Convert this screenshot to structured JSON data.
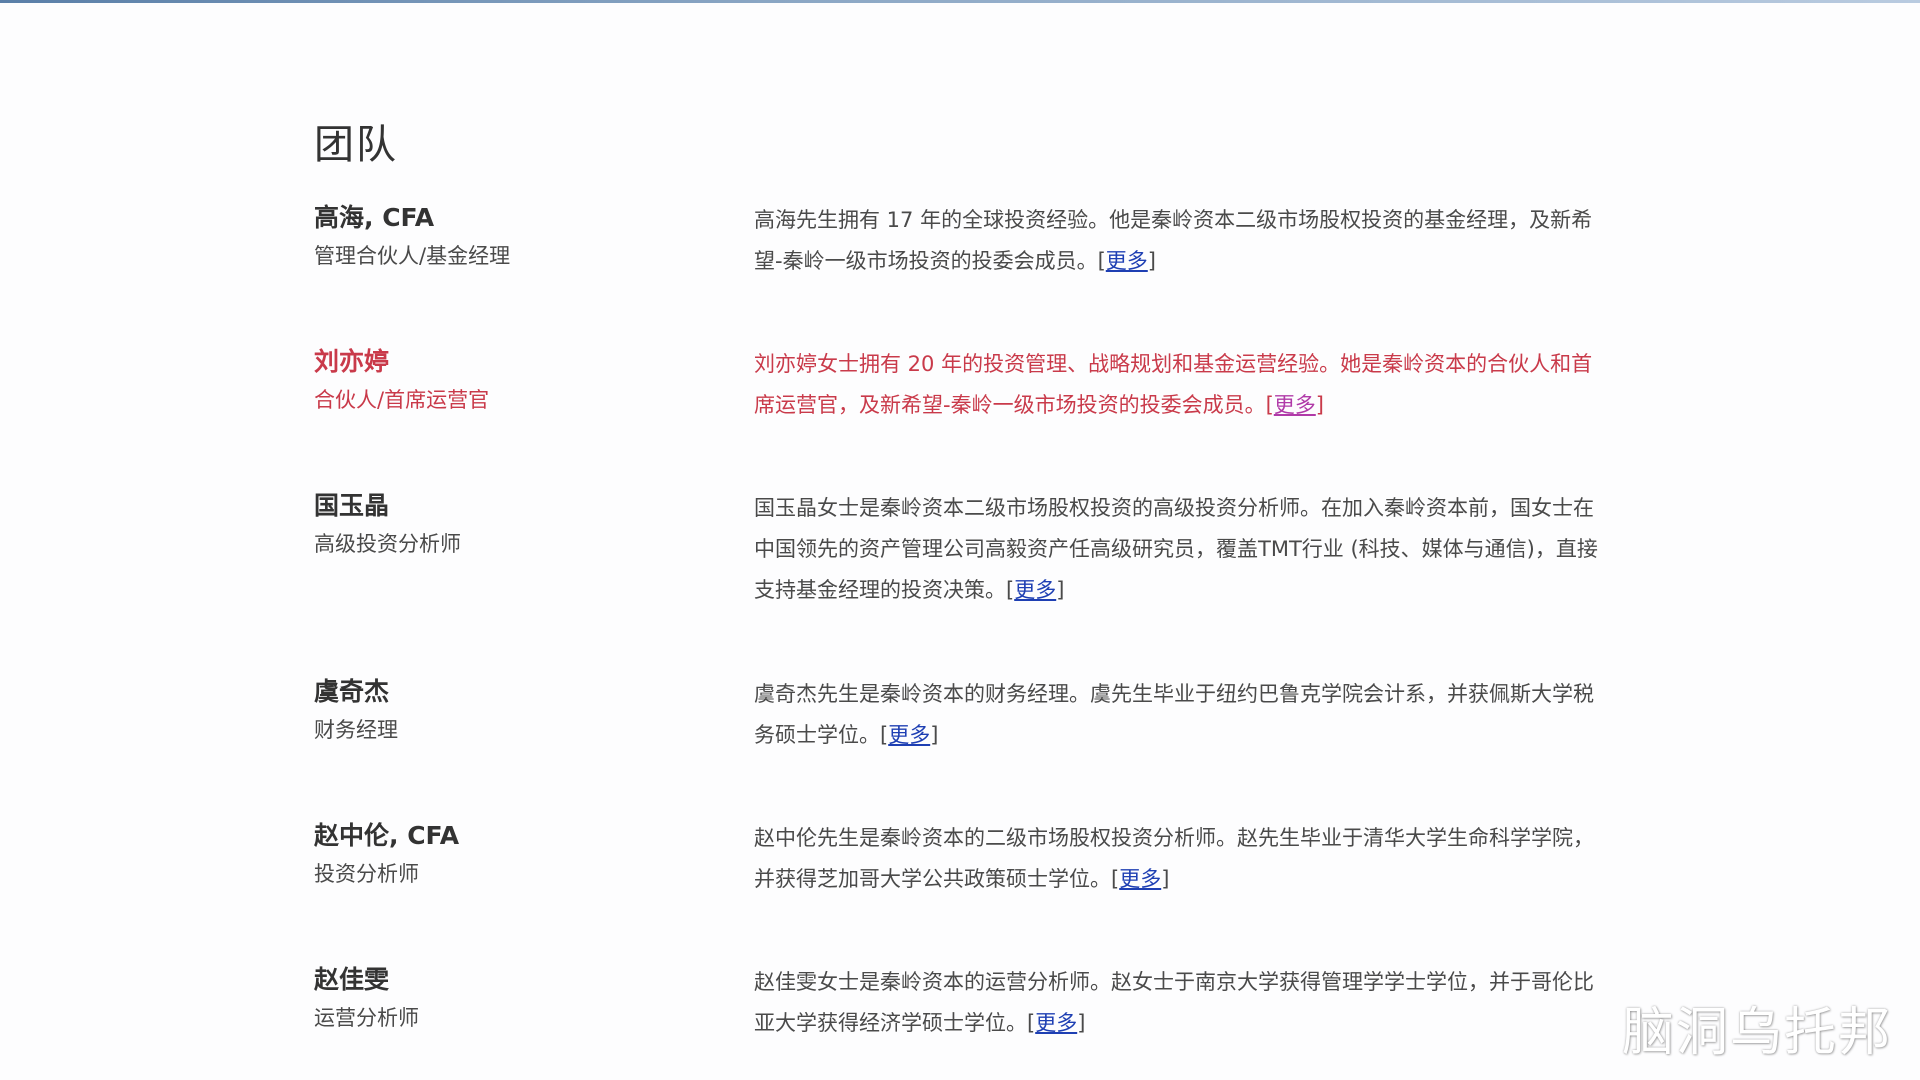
{
  "section": {
    "title": "团队"
  },
  "members": [
    {
      "name": "高海, CFA",
      "role": "管理合伙人/基金经理",
      "bio": "高海先生拥有 17 年的全球投资经验。他是秦岭资本二级市场股权投资的基金经理，及新希望-秦岭一级市场投资的投委会成员。",
      "more": "更多"
    },
    {
      "name": "刘亦婷",
      "role": "合伙人/首席运营官",
      "bio": "刘亦婷女士拥有 20 年的投资管理、战略规划和基金运营经验。她是秦岭资本的合伙人和首席运营官，及新希望-秦岭一级市场投资的投委会成员。",
      "more": "更多"
    },
    {
      "name": "国玉晶",
      "role": "高级投资分析师",
      "bio": "国玉晶女士是秦岭资本二级市场股权投资的高级投资分析师。在加入秦岭资本前，国女士在中国领先的资产管理公司高毅资产任高级研究员，覆盖TMT行业 (科技、媒体与通信)，直接支持基金经理的投资决策。",
      "more": "更多"
    },
    {
      "name": "虞奇杰",
      "role": "财务经理",
      "bio": "虞奇杰先生是秦岭资本的财务经理。虞先生毕业于纽约巴鲁克学院会计系，并获佩斯大学税务硕士学位。",
      "more": "更多"
    },
    {
      "name": "赵中伦, CFA",
      "role": "投资分析师",
      "bio": "赵中伦先生是秦岭资本的二级市场股权投资分析师。赵先生毕业于清华大学生命科学学院，并获得芝加哥大学公共政策硕士学位。",
      "more": "更多"
    },
    {
      "name": "赵佳雯",
      "role": "运营分析师",
      "bio": "赵佳雯女士是秦岭资本的运营分析师。赵女士于南京大学获得管理学学士学位，并于哥伦比亚大学获得经济学硕士学位。",
      "more": "更多"
    }
  ],
  "watermark": "脑洞乌托邦",
  "colors": {
    "text": "#4a4a4a",
    "heading": "#333333",
    "highlight": "#c93a4a",
    "link": "#1e3fb3"
  }
}
